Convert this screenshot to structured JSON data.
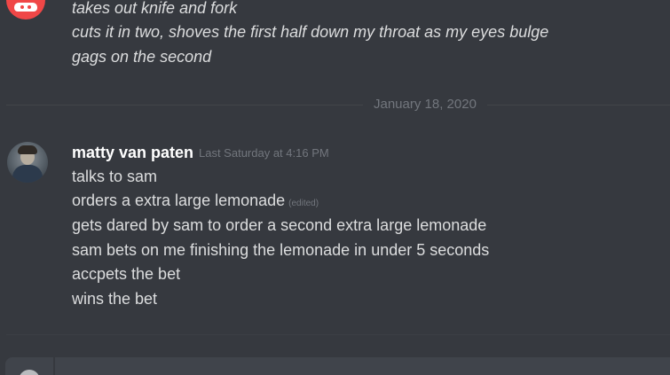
{
  "previous_message": {
    "lines": [
      "takes out knife and fork",
      "cuts it in two, shoves the first half down my throat as my eyes bulge",
      "gags on the second"
    ]
  },
  "date_divider": {
    "label": "January 18, 2020"
  },
  "message": {
    "author": "matty van paten",
    "timestamp": "Last Saturday at 4:16 PM",
    "edited_tag": "(edited)",
    "lines": [
      "talks to sam",
      "orders a extra large lemonade",
      "gets dared by sam to order a second extra large lemonade",
      "sam bets on me finishing the lemonade  in under 5 seconds",
      "accpets the bet",
      "wins the bet"
    ]
  },
  "icons": {
    "previous_avatar": "discord-logo-icon",
    "author_avatar": "user-avatar",
    "upload": "upload-plus-icon"
  },
  "colors": {
    "background": "#36393f",
    "text": "#dcddde",
    "muted": "#72767d",
    "author": "#ffffff",
    "avatar_red": "#f04747",
    "composer": "#40444b"
  }
}
